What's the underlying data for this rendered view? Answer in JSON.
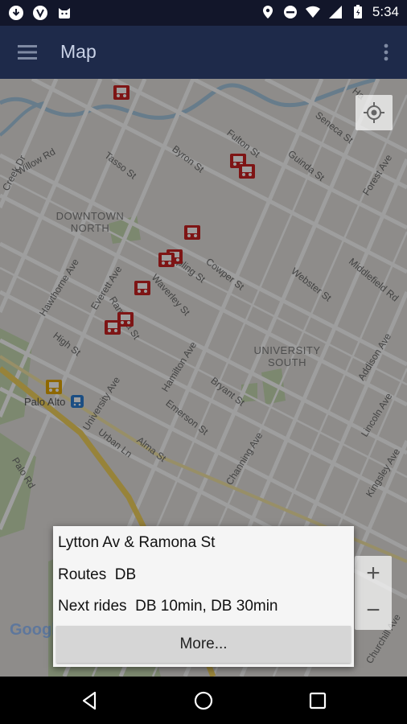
{
  "status_bar": {
    "time": "5:34"
  },
  "app_bar": {
    "title": "Map"
  },
  "map": {
    "streets": [
      {
        "name": "Willow Rd"
      },
      {
        "name": "Creek Dr"
      },
      {
        "name": "Tasso St"
      },
      {
        "name": "Byron St"
      },
      {
        "name": "Fulton St"
      },
      {
        "name": "Guinda St"
      },
      {
        "name": "Seneca St"
      },
      {
        "name": "Forest Ave"
      },
      {
        "name": "Hawthorne Ave"
      },
      {
        "name": "Everett Ave"
      },
      {
        "name": "Kipling St"
      },
      {
        "name": "Waverley St"
      },
      {
        "name": "Ramona St"
      },
      {
        "name": "High St"
      },
      {
        "name": "Cowper St"
      },
      {
        "name": "Webster St"
      },
      {
        "name": "Middlefield Rd"
      },
      {
        "name": "Hamilton Ave"
      },
      {
        "name": "Bryant St"
      },
      {
        "name": "Emerson St"
      },
      {
        "name": "University Ave"
      },
      {
        "name": "Urban Ln"
      },
      {
        "name": "Alma St"
      },
      {
        "name": "Channing Ave"
      },
      {
        "name": "Addison Ave"
      },
      {
        "name": "Lincoln Ave"
      },
      {
        "name": "Kingsley Ave"
      },
      {
        "name": "Palo Rd"
      },
      {
        "name": "Churchill Ave"
      },
      {
        "name": "Palo Alto"
      },
      {
        "name": "Ha"
      }
    ],
    "areas": [
      {
        "name": "DOWNTOWN NORTH"
      },
      {
        "name": "UNIVERSITY SOUTH"
      }
    ],
    "zoom_in": "+",
    "zoom_out": "−",
    "attribution": "Google"
  },
  "popup": {
    "stop_name": "Lytton Av & Ramona St",
    "routes_label": "Routes",
    "routes_value": "DB",
    "next_rides_label": "Next rides",
    "next_rides_value": "DB 10min, DB 30min",
    "more_button": "More..."
  }
}
